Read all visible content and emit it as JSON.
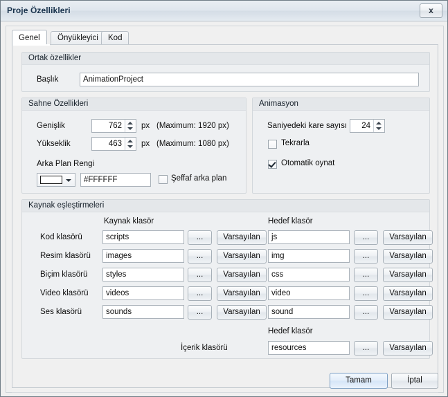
{
  "window": {
    "title": "Proje Özellikleri",
    "close_label": "x"
  },
  "tabs": [
    {
      "label": "Genel",
      "selected": true
    },
    {
      "label": "Önyükleyici",
      "selected": false
    },
    {
      "label": "Kod",
      "selected": false
    }
  ],
  "common_group": {
    "title": "Ortak özellikler",
    "title_label": "Başlık",
    "title_value": "AnimationProject"
  },
  "scene_group": {
    "title": "Sahne Özellikleri",
    "width_label": "Genişlik",
    "width_value": "762",
    "width_unit": "px",
    "width_max": "(Maximum: 1920 px)",
    "height_label": "Yükseklik",
    "height_value": "463",
    "height_unit": "px",
    "height_max": "(Maximum: 1080 px)",
    "bgcolor_label": "Arka Plan Rengi",
    "bgcolor_value": "#FFFFFF",
    "bgcolor_swatch": "#FFFFFF",
    "transparent_label": "Şeffaf arka plan",
    "transparent_checked": false
  },
  "animation_group": {
    "title": "Animasyon",
    "fps_label": "Saniyedeki kare sayısı",
    "fps_value": "24",
    "loop_label": "Tekrarla",
    "loop_checked": false,
    "autoplay_label": "Otomatik oynat",
    "autoplay_checked": true
  },
  "resources_group": {
    "title": "Kaynak eşleştirmeleri",
    "source_header": "Kaynak klasör",
    "target_header": "Hedef klasör",
    "content_target_header": "Hedef klasör",
    "browse_label": "...",
    "default_label": "Varsayılan",
    "rows": [
      {
        "label": "Kod klasörü",
        "source": "scripts",
        "target": "js"
      },
      {
        "label": "Resim klasörü",
        "source": "images",
        "target": "img"
      },
      {
        "label": "Biçim klasörü",
        "source": "styles",
        "target": "css"
      },
      {
        "label": "Video klasörü",
        "source": "videos",
        "target": "video"
      },
      {
        "label": "Ses klasörü",
        "source": "sounds",
        "target": "sound"
      }
    ],
    "content_row": {
      "label": "İçerik klasörü",
      "target": "resources"
    }
  },
  "footer": {
    "ok_label": "Tamam",
    "cancel_label": "İptal"
  }
}
